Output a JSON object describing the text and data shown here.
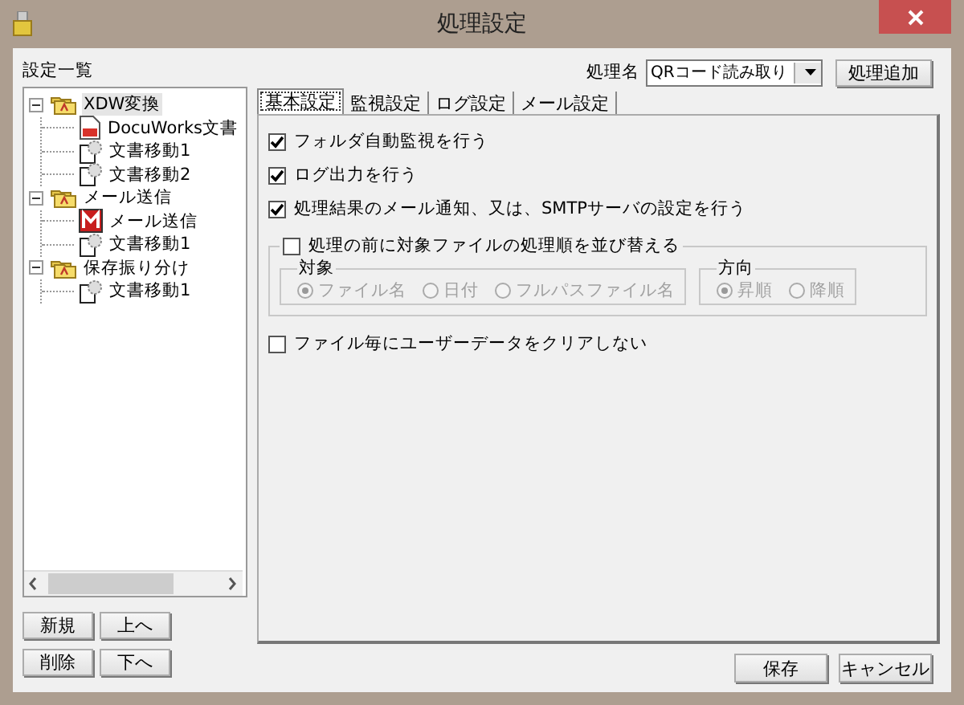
{
  "window": {
    "title": "処理設定"
  },
  "sidebar": {
    "label": "設定一覧",
    "tree": [
      {
        "label": "XDW変換",
        "kind": "folder",
        "expanded": true,
        "selected": true,
        "children": [
          {
            "label": "DocuWorks文書",
            "kind": "docuworks",
            "selected": false
          },
          {
            "label": "文書移動1",
            "kind": "move",
            "selected": false
          },
          {
            "label": "文書移動2",
            "kind": "move",
            "selected": false
          }
        ]
      },
      {
        "label": "メール送信",
        "kind": "folder",
        "expanded": true,
        "selected": false,
        "children": [
          {
            "label": "メール送信",
            "kind": "mail",
            "selected": false
          },
          {
            "label": "文書移動1",
            "kind": "move",
            "selected": false
          }
        ]
      },
      {
        "label": "保存振り分け",
        "kind": "folder",
        "expanded": true,
        "selected": false,
        "children": [
          {
            "label": "文書移動1",
            "kind": "move",
            "selected": false
          }
        ]
      }
    ],
    "buttons": [
      "新規",
      "上へ",
      "削除",
      "下へ"
    ]
  },
  "process": {
    "label": "処理名",
    "value": "QRコード読み取り",
    "add_button": "処理追加"
  },
  "tabs": [
    {
      "label": "基本設定",
      "selected": true
    },
    {
      "label": "監視設定",
      "selected": false
    },
    {
      "label": "ログ設定",
      "selected": false
    },
    {
      "label": "メール設定",
      "selected": false
    }
  ],
  "options": [
    {
      "label": "フォルダ自動監視を行う",
      "checked": true
    },
    {
      "label": "ログ出力を行う",
      "checked": true
    },
    {
      "label": "処理結果のメール通知、又は、SMTPサーバの設定を行う",
      "checked": true
    }
  ],
  "sort_group": {
    "label": "処理の前に対象ファイルの処理順を並び替える",
    "checked": false,
    "groups": [
      {
        "label": "対象",
        "options": [
          {
            "label": "ファイル名",
            "selected": true,
            "disabled": true
          },
          {
            "label": "日付",
            "selected": false,
            "disabled": true
          },
          {
            "label": "フルパスファイル名",
            "selected": false,
            "disabled": true
          }
        ]
      },
      {
        "label": "方向",
        "options": [
          {
            "label": "昇順",
            "selected": true,
            "disabled": true
          },
          {
            "label": "降順",
            "selected": false,
            "disabled": true
          }
        ]
      }
    ]
  },
  "last_option": {
    "label": "ファイル毎にユーザーデータをクリアしない",
    "checked": false
  },
  "footer_buttons": [
    "保存",
    "キャンセル"
  ]
}
